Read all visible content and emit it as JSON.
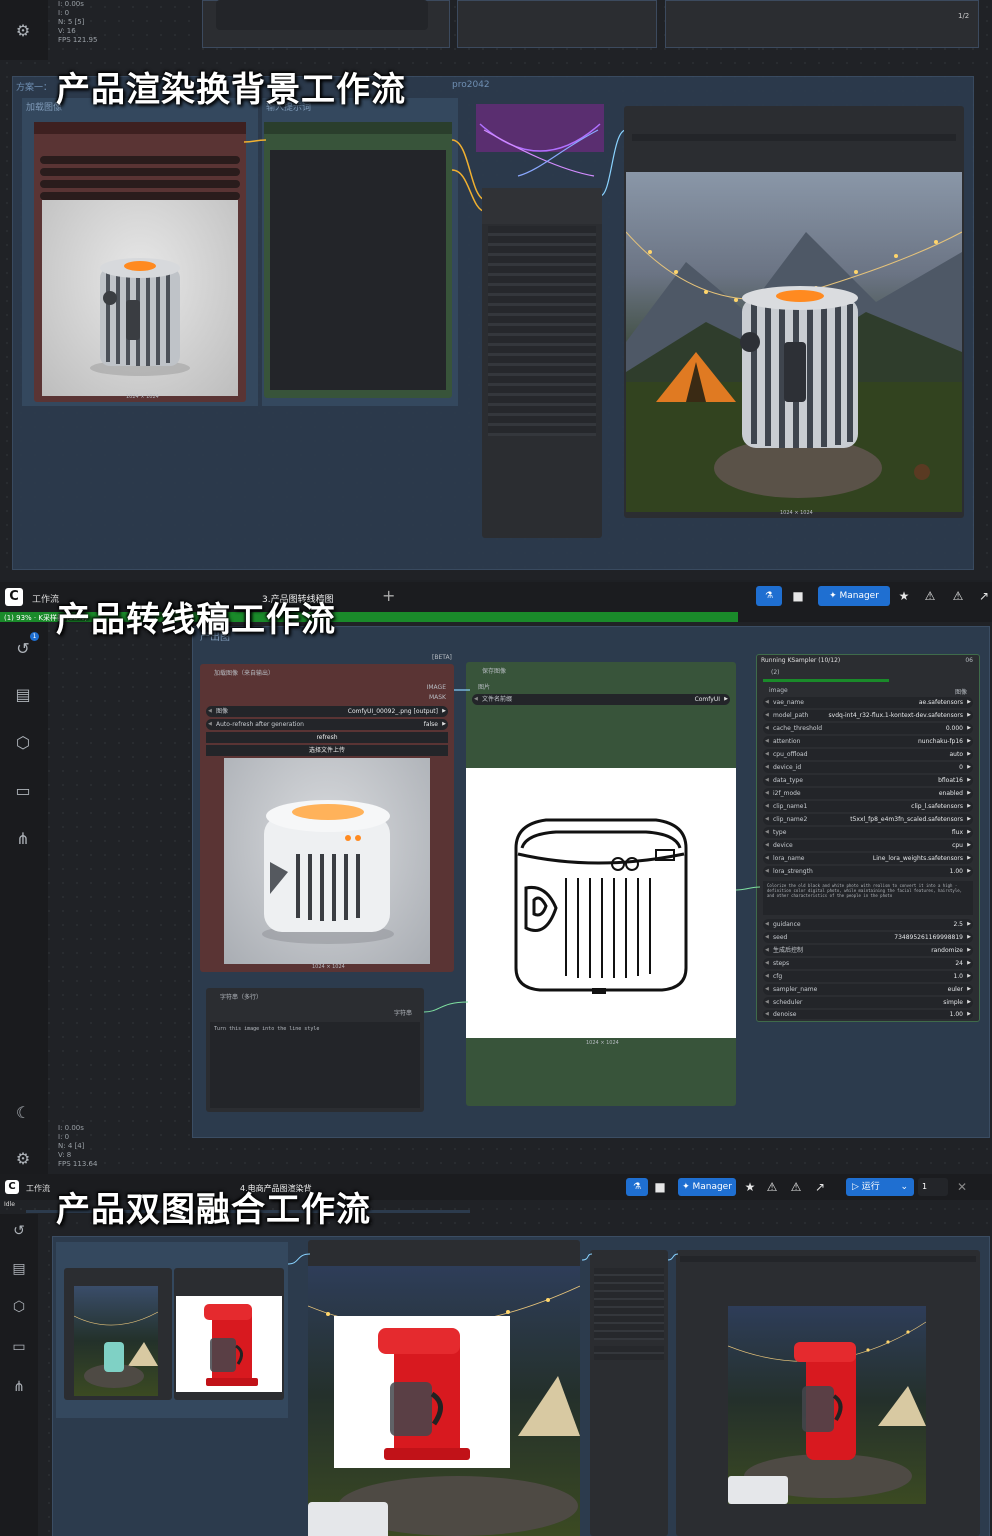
{
  "banners": {
    "s1": "产品渲染换背景工作流",
    "s2": "产品转线稿工作流",
    "s3": "产品双图融合工作流"
  },
  "s1": {
    "stats": [
      "I: 0.00s",
      "I: 0",
      "N: 5 [5]",
      "V: 16",
      "FPS 121.95"
    ],
    "page_indicator": "1/2",
    "group_label_left": "方案一：",
    "group_label_right": "pro2042",
    "node1_title": "加载图像",
    "node2_title": "输入提示词",
    "img1_caption": "1024 × 1024",
    "img2_caption": "1024 × 1024"
  },
  "s2": {
    "tab_app": "工作流",
    "tab_name": "3.产品图转线稿图",
    "progress_label": "(1) 93% · K采样器 (58%)",
    "manager_label": "Manager",
    "group_title": "产出图",
    "load_node": {
      "title": "加载图像（来自输出）",
      "beta": "[BETA]",
      "out1": "IMAGE",
      "out2": "MASK",
      "image_label": "图像",
      "image_value": "ComfyUI_00092_.png [output]",
      "auto_refresh": "Auto-refresh after generation",
      "auto_value": "false",
      "refresh_btn": "refresh",
      "choose_btn": "选择文件上传",
      "caption": "1024 × 1024"
    },
    "text_node": {
      "title": "字符串（多行）",
      "out": "字符串",
      "text": "Turn this image into the line style"
    },
    "save_node": {
      "title": "保存图像",
      "in": "图片",
      "prefix_label": "文件名前缀",
      "prefix_value": "ComfyUI",
      "caption": "1024 × 1024"
    },
    "ksampler": {
      "title": "Running KSampler (10/12)",
      "badge": "06",
      "sub": "(2)",
      "in_image": "image",
      "out_image": "图像",
      "prompt": "Colorize the old black and white photo with realism to convert it into a high · definition color digital photo, while maintaining the facial features, hairstyle, and other characteristics of the people in the photo",
      "params_top": [
        {
          "k": "vae_name",
          "v": "ae.safetensors"
        },
        {
          "k": "model_path",
          "v": "svdq-int4_r32-flux.1-kontext-dev.safetensors"
        },
        {
          "k": "cache_threshold",
          "v": "0.000"
        },
        {
          "k": "attention",
          "v": "nunchaku-fp16"
        },
        {
          "k": "cpu_offload",
          "v": "auto"
        },
        {
          "k": "device_id",
          "v": "0"
        },
        {
          "k": "data_type",
          "v": "bfloat16"
        },
        {
          "k": "i2f_mode",
          "v": "enabled"
        },
        {
          "k": "clip_name1",
          "v": "clip_l.safetensors"
        },
        {
          "k": "clip_name2",
          "v": "t5xxl_fp8_e4m3fn_scaled.safetensors"
        },
        {
          "k": "type",
          "v": "flux"
        },
        {
          "k": "device",
          "v": "cpu"
        },
        {
          "k": "lora_name",
          "v": "Line_lora_weights.safetensors"
        },
        {
          "k": "lora_strength",
          "v": "1.00"
        }
      ],
      "params_bottom": [
        {
          "k": "guidance",
          "v": "2.5"
        },
        {
          "k": "seed",
          "v": "734895261169998819"
        },
        {
          "k": "生成后控制",
          "v": "randomize"
        },
        {
          "k": "steps",
          "v": "24"
        },
        {
          "k": "cfg",
          "v": "1.0"
        },
        {
          "k": "sampler_name",
          "v": "euler"
        },
        {
          "k": "scheduler",
          "v": "simple"
        },
        {
          "k": "denoise",
          "v": "1.00"
        }
      ]
    },
    "stats": [
      "I: 0.00s",
      "I: 0",
      "N: 4 [4]",
      "V: 8",
      "FPS 113.64"
    ]
  },
  "s3": {
    "tab_app": "工作流",
    "tab_name": "4.电商产品图渲染背",
    "status": "Idle",
    "manager_label": "Manager",
    "run_label": "运行",
    "run_count": "1"
  },
  "colors": {
    "node_red": "#5a3434",
    "node_green": "#38543a",
    "node_purple": "#5a2e70",
    "accent_blue": "#1f6fd1",
    "progress_green": "#1a8a2a"
  },
  "icons": [
    "gear-icon",
    "history-icon",
    "document-icon",
    "cube-icon",
    "folder-icon",
    "tree-icon",
    "moon-icon",
    "star-icon",
    "bookmark-icon",
    "share-icon",
    "close-icon",
    "chevron-down-icon",
    "logo-icon",
    "plus-icon",
    "manager-icon",
    "run-icon"
  ]
}
